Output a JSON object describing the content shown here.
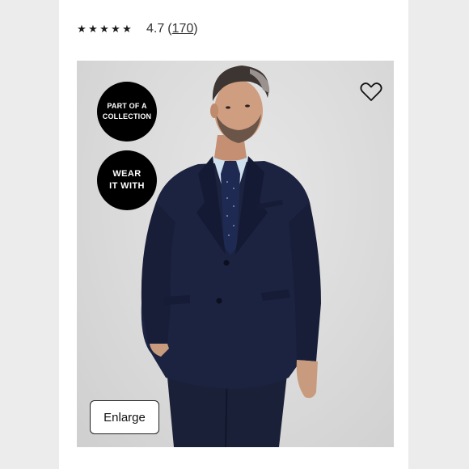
{
  "rating": {
    "stars": [
      "★",
      "★",
      "★",
      "★",
      "★"
    ],
    "value": "4.7",
    "open_paren": "(",
    "count": "170",
    "close_paren": ")"
  },
  "badges": {
    "collection_line1": "PART OF A",
    "collection_line2": "COLLECTION",
    "wear_line1": "WEAR",
    "wear_line2": "IT WITH"
  },
  "favorite": {
    "icon": "heart-outline-icon"
  },
  "enlarge_label": "Enlarge",
  "colors": {
    "badge_bg": "#000000",
    "suit": "#1c2340",
    "shirt": "#cfe0ef",
    "tie": "#1f2a52"
  }
}
